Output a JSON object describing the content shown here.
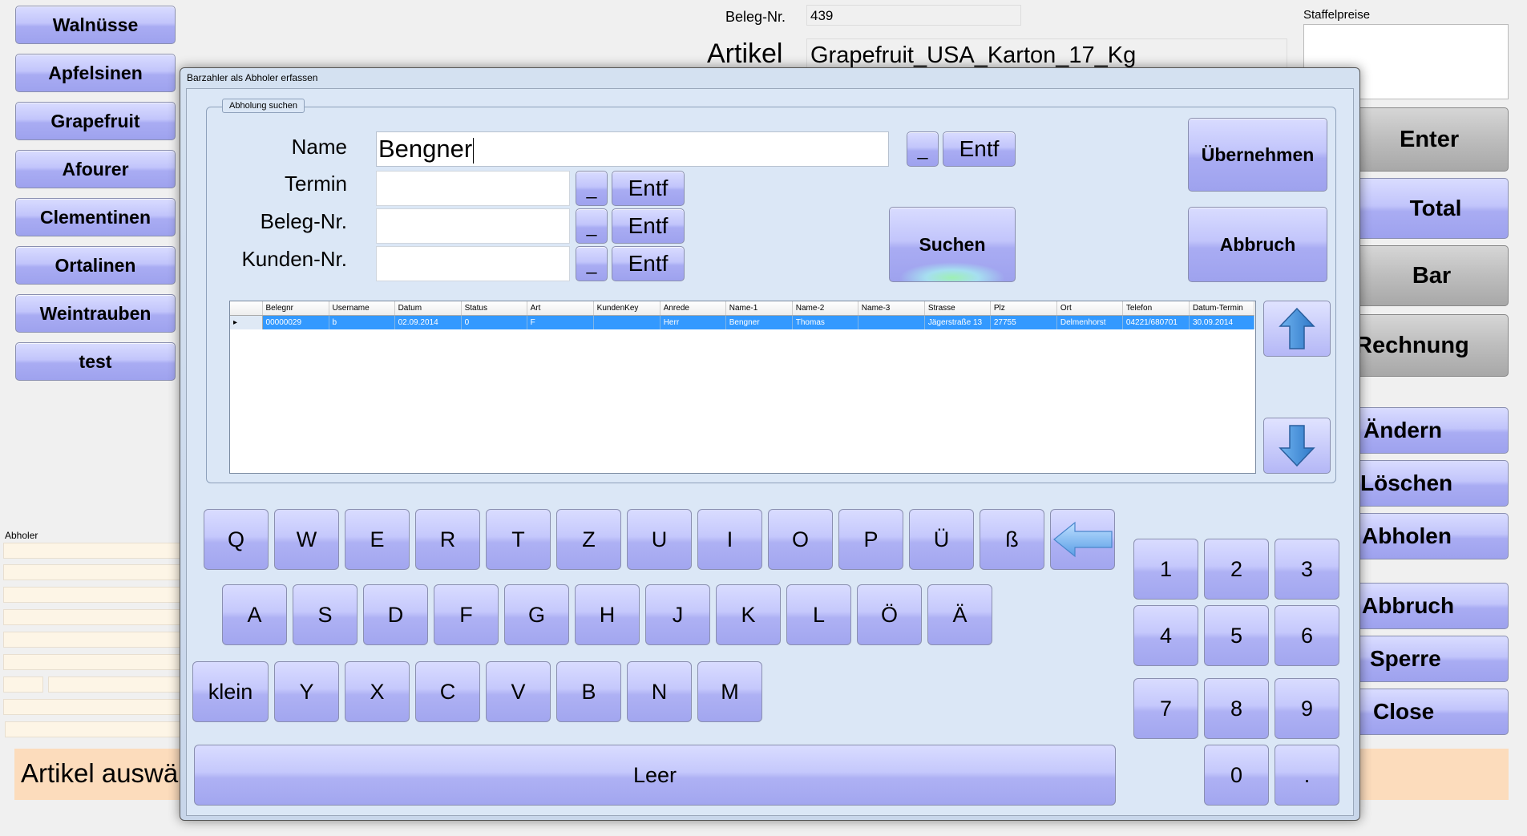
{
  "background": {
    "left_buttons": [
      "Walnüsse",
      "Apfelsinen",
      "Grapefruit",
      "Afourer",
      "Clementinen",
      "Ortalinen",
      "Weintrauben",
      "test"
    ],
    "beleg_label": "Beleg-Nr.",
    "beleg_value": "439",
    "artikel_label": "Artikel",
    "artikel_value": "Grapefruit_USA_Karton_17_Kg",
    "staffel_label": "Staffelpreise",
    "abholer_label": "Abholer",
    "status_text": "Artikel auswä",
    "right_buttons": [
      "Enter",
      "Total",
      "Bar",
      "Rechnung",
      "Ändern",
      "Löschen",
      "Abholen",
      "Abbruch",
      "Sperre",
      "Close"
    ]
  },
  "dialog": {
    "title": "Barzahler als Abholer erfassen",
    "group_label": "Abholung suchen",
    "name_label": "Name",
    "name_value": "Bengner",
    "termin_label": "Termin",
    "beleg_label": "Beleg-Nr.",
    "kunden_label": "Kunden-Nr.",
    "underscore": "_",
    "entf": "Entf",
    "suchen": "Suchen",
    "uebernehmen": "Übernehmen",
    "abbruch": "Abbruch",
    "leer": "Leer",
    "klein": "klein",
    "accent_color": "#a9acf3",
    "selected_row_color": "#3399ff"
  },
  "grid": {
    "columns": [
      "Belegnr",
      "Username",
      "Datum",
      "Status",
      "Art",
      "KundenKey",
      "Anrede",
      "Name-1",
      "Name-2",
      "Name-3",
      "Strasse",
      "Plz",
      "Ort",
      "Telefon",
      "Datum-Termin"
    ],
    "rows": [
      [
        "00000029",
        "b",
        "02.09.2014",
        "0",
        "F",
        "",
        "Herr",
        "Bengner",
        "Thomas",
        "",
        "Jägerstraße 13",
        "27755",
        "Delmenhorst",
        "04221/680701",
        "30.09.2014"
      ]
    ]
  },
  "keyboard": {
    "row1": [
      "Q",
      "W",
      "E",
      "R",
      "T",
      "Z",
      "U",
      "I",
      "O",
      "P",
      "Ü",
      "ß"
    ],
    "row2": [
      "A",
      "S",
      "D",
      "F",
      "G",
      "H",
      "J",
      "K",
      "L",
      "Ö",
      "Ä"
    ],
    "row3": [
      "Y",
      "X",
      "C",
      "V",
      "B",
      "N",
      "M"
    ],
    "numpad": [
      "1",
      "2",
      "3",
      "4",
      "5",
      "6",
      "7",
      "8",
      "9",
      "0",
      "."
    ]
  }
}
